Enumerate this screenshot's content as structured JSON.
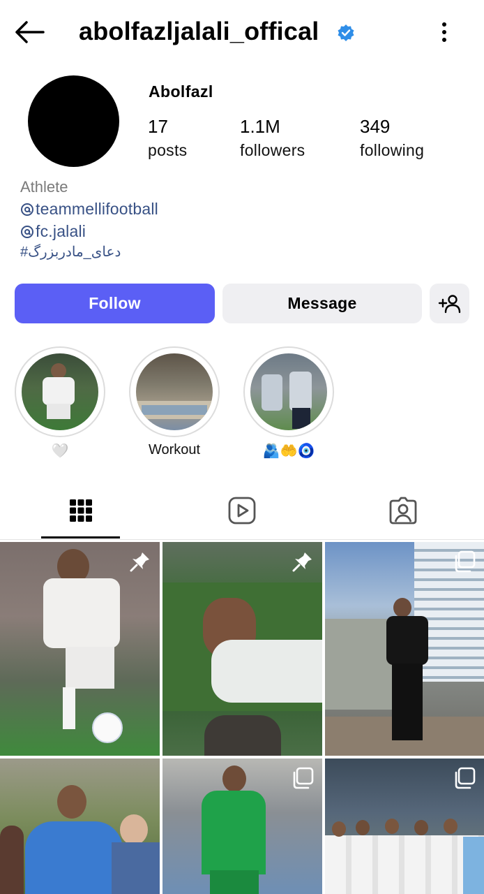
{
  "header": {
    "username": "abolfazljalali_offical",
    "verified": true,
    "back_icon": "arrow-left-icon",
    "more_icon": "vertical-ellipsis-icon"
  },
  "profile": {
    "display_name": "Abolfazl",
    "stats": [
      {
        "value": "17",
        "label": "posts"
      },
      {
        "value": "1.1M",
        "label": "followers"
      },
      {
        "value": "349",
        "label": "following"
      }
    ],
    "category": "Athlete",
    "links": [
      {
        "icon": "threads-icon",
        "text": "teammellifootball"
      },
      {
        "icon": "threads-icon",
        "text": "fc.jalali"
      }
    ],
    "hashtag": "#دعای_مادربزرگ"
  },
  "actions": {
    "follow_label": "Follow",
    "message_label": "Message",
    "add_user_icon": "add-person-icon"
  },
  "highlights": [
    {
      "label": "🤍"
    },
    {
      "label": "Workout"
    },
    {
      "label": "🫂🤲🧿"
    }
  ],
  "tabs": [
    {
      "icon": "grid-icon",
      "selected": true
    },
    {
      "icon": "reels-icon",
      "selected": false
    },
    {
      "icon": "tagged-icon",
      "selected": false
    }
  ],
  "grid": [
    {
      "badge": "pin-icon"
    },
    {
      "badge": "pin-icon"
    },
    {
      "badge": "carousel-icon"
    },
    {
      "badge": ""
    },
    {
      "badge": "carousel-icon"
    },
    {
      "badge": "carousel-icon"
    }
  ],
  "colors": {
    "accent": "#5b5ff5",
    "link": "#385185",
    "verified": "#2f8ee8",
    "secondary_button": "#efeff2"
  }
}
